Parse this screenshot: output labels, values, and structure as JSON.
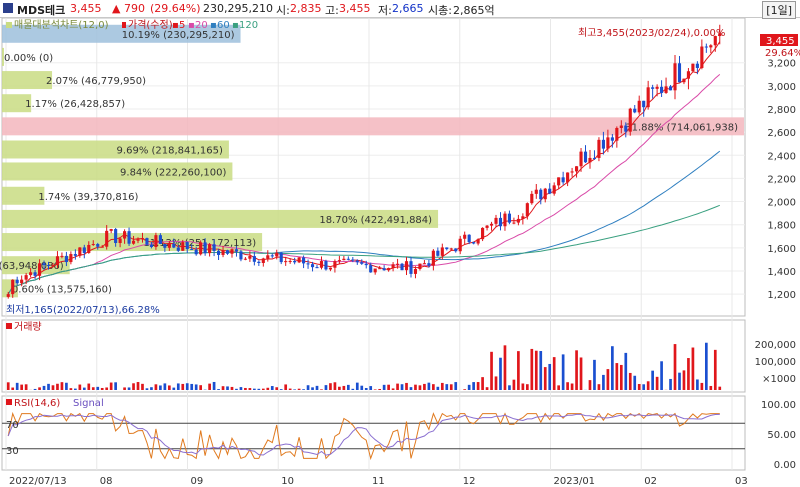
{
  "header": {
    "name": "MDS테크",
    "price": "3,455",
    "change": "▲ 790",
    "change_pct": "(29.64%)",
    "volume": "230,295,210",
    "open_label": "시:",
    "open": "2,835",
    "high_label": "고:",
    "high": "3,455",
    "low_label": "저:",
    "low": "2,665",
    "mcap_label": "시총:",
    "mcap": "2,865억",
    "period": "[1일]"
  },
  "legend_top": {
    "vp": "매물대분석차트(12,0)",
    "price": "가격(수정)",
    "ma5": "5",
    "ma20": "20",
    "ma60": "60",
    "ma120": "120"
  },
  "volume_profile": [
    {
      "label": "10.19% (230,295,210)",
      "price": 3450,
      "pct": 10.19,
      "color": "#9dbfdc"
    },
    {
      "label": "0.00% (0)",
      "price": 3250,
      "pct": 0.0,
      "color": "#c9dc82"
    },
    {
      "label": "2.07% (46,779,950)",
      "price": 3050,
      "pct": 2.07,
      "color": "#c9dc82"
    },
    {
      "label": "1.17% (26,428,857)",
      "price": 2850,
      "pct": 1.17,
      "color": "#c9dc82"
    },
    {
      "label": "31.88% (714,061,938)",
      "price": 2650,
      "pct": 31.88,
      "color": "#f3b6bd"
    },
    {
      "label": "9.69% (218,841,165)",
      "price": 2450,
      "pct": 9.69,
      "color": "#c9dc82"
    },
    {
      "label": "9.84% (222,260,100)",
      "price": 2260,
      "pct": 9.84,
      "color": "#c9dc82"
    },
    {
      "label": "1.74% (39,370,816)",
      "price": 2050,
      "pct": 1.74,
      "color": "#c9dc82"
    },
    {
      "label": "18.70% (422,491,884)",
      "price": 1850,
      "pct": 18.7,
      "color": "#c9dc82"
    },
    {
      "label": "11.12% (251,172,113)",
      "price": 1650,
      "pct": 11.12,
      "color": "#c9dc82"
    },
    {
      "label": "2.83% (63,948,086)",
      "price": 1450,
      "pct": 2.83,
      "color": "#c9dc82"
    },
    {
      "label": "0.60% (13,575,160)",
      "price": 1250,
      "pct": 0.6,
      "color": "#c9dc82"
    }
  ],
  "annotations": {
    "high": "최고3,455(2023/02/24),0.00%",
    "low": "최저1,165(2022/07/13),66.28%",
    "last_price_tag": "3,455",
    "last_pct_tag": "29.64%"
  },
  "price_axis": {
    "ticks": [
      "3,200",
      "3,000",
      "2,800",
      "2,600",
      "2,400",
      "2,200",
      "2,000",
      "1,800",
      "1,600",
      "1,400",
      "1,200"
    ],
    "min": 1080,
    "max": 3500
  },
  "volume_panel": {
    "title": "거래량",
    "ticks": [
      "200,000",
      "100,000",
      "×1000"
    ]
  },
  "rsi_panel": {
    "title": "RSI(14,6)",
    "signal": "Signal",
    "ticks": [
      "100.00",
      "50.00",
      "0.00"
    ],
    "levels": [
      "70",
      "30"
    ]
  },
  "x_axis": {
    "labels": [
      "2022/07/13",
      "08",
      "09",
      "10",
      "11",
      "12",
      "2023/01",
      "02",
      "03"
    ]
  },
  "chart_data": {
    "type": "candlestick",
    "title": "MDS테크",
    "x_range": [
      "2022/07/13",
      "2023/02/24"
    ],
    "y_range": [
      1080,
      3500
    ],
    "close_monthly": [
      {
        "x": "2022/07",
        "close": 1300
      },
      {
        "x": "2022/08",
        "close": 1700
      },
      {
        "x": "2022/09",
        "close": 1580
      },
      {
        "x": "2022/10",
        "close": 1460
      },
      {
        "x": "2022/11",
        "close": 1430
      },
      {
        "x": "2022/12",
        "close": 1900
      },
      {
        "x": "2023/01",
        "close": 2650
      },
      {
        "x": "2023/02",
        "close": 3455
      }
    ],
    "rsi_levels": [
      70,
      30
    ],
    "colors": {
      "up": "#e0161b",
      "down": "#1a4fd0",
      "ma5": "#e0161b",
      "ma20": "#d94aa8",
      "ma60": "#2f7fc0",
      "ma120": "#3aa080"
    }
  }
}
